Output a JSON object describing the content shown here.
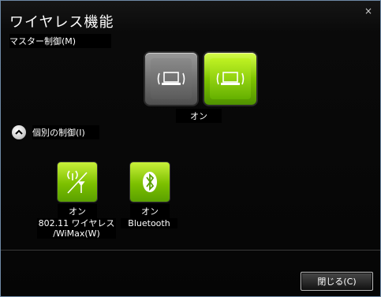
{
  "window": {
    "title": "ワイヤレス機能",
    "close_glyph": "×"
  },
  "master": {
    "label": "マスター制御(M)",
    "status": "オン"
  },
  "individual": {
    "label": "個別の制御(I)",
    "devices": [
      {
        "icon": "wireless-antenna-icon",
        "status": "オン",
        "name_line1": "802.11 ワイヤレス",
        "name_line2": "/WiMax(W)"
      },
      {
        "icon": "bluetooth-icon",
        "status": "オン",
        "name_line1": "Bluetooth"
      }
    ]
  },
  "footer": {
    "close_button": "閉じる(C)"
  },
  "colors": {
    "accent_green": "#7ec400",
    "off_gray": "#6e6e6e"
  }
}
